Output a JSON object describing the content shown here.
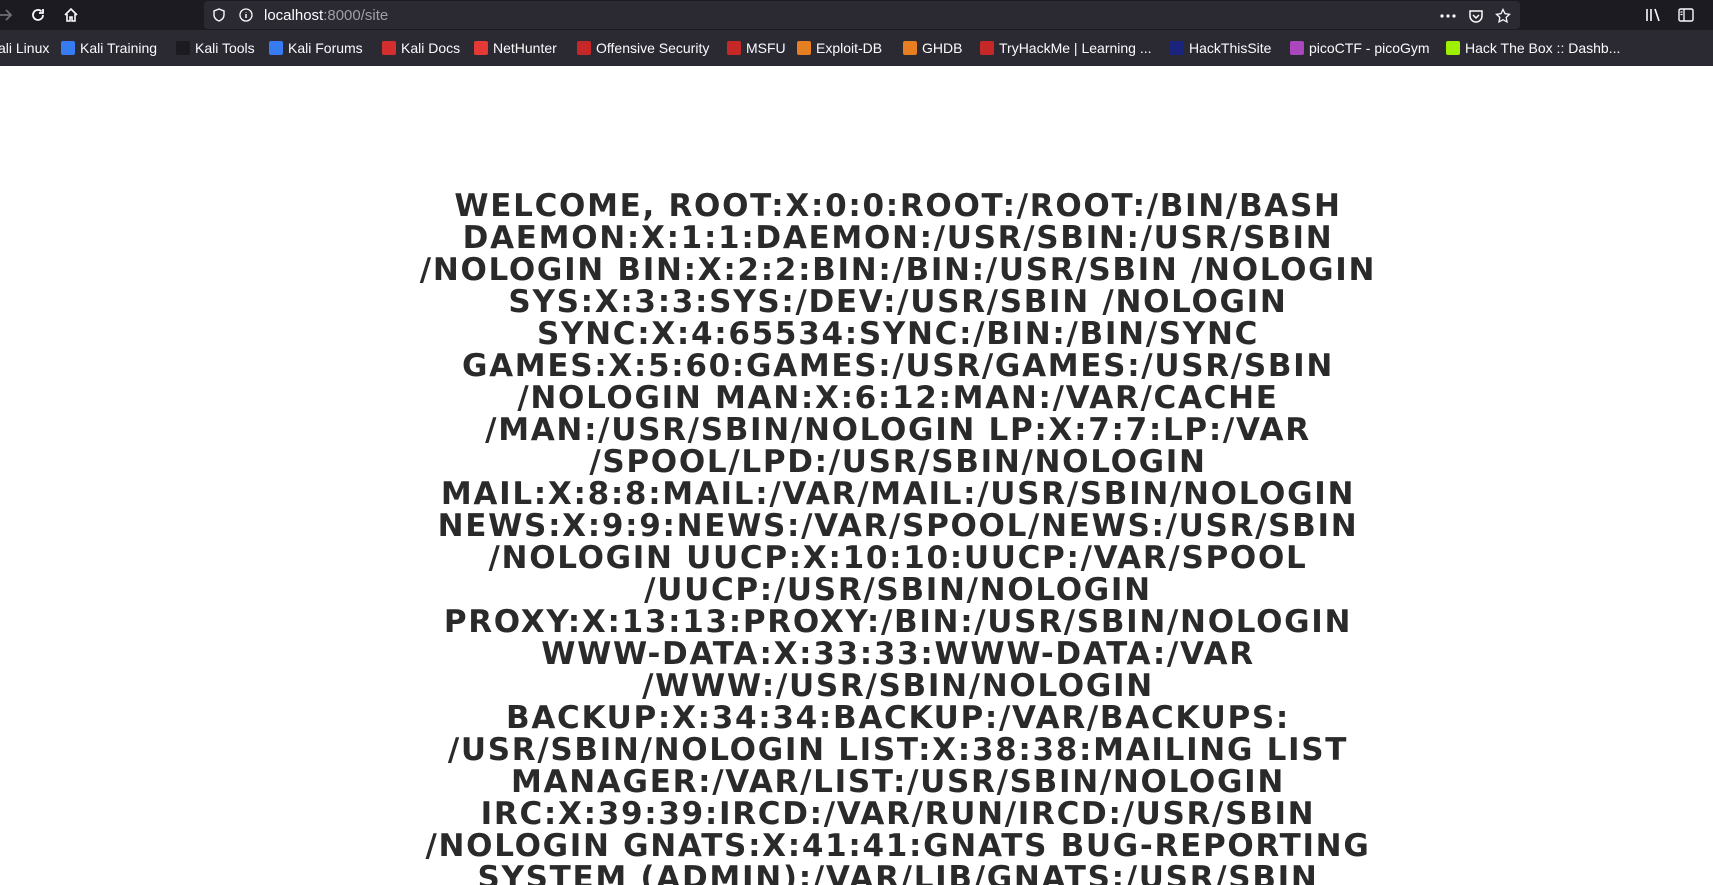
{
  "browser": {
    "url_host": "localhost",
    "url_path": ":8000/site",
    "bookmarks": [
      {
        "label": "ali Linux",
        "color": "#367bf0"
      },
      {
        "label": "Kali Training",
        "color": "#367bf0"
      },
      {
        "label": "Kali Tools",
        "color": "#1c1b22"
      },
      {
        "label": "Kali Forums",
        "color": "#367bf0"
      },
      {
        "label": "Kali Docs",
        "color": "#d32f2f"
      },
      {
        "label": "NetHunter",
        "color": "#e53935"
      },
      {
        "label": "Offensive Security",
        "color": "#c62828"
      },
      {
        "label": "MSFU",
        "color": "#c62828"
      },
      {
        "label": "Exploit-DB",
        "color": "#e67e22"
      },
      {
        "label": "GHDB",
        "color": "#e67e22"
      },
      {
        "label": "TryHackMe | Learning ...",
        "color": "#c62828"
      },
      {
        "label": "HackThisSite",
        "color": "#1a237e"
      },
      {
        "label": "picoCTF - picoGym",
        "color": "#ab47bc"
      },
      {
        "label": "Hack The Box :: Dashb...",
        "color": "#9fef00"
      }
    ]
  },
  "page": {
    "welcome_text": "WELCOME, ROOT:X:0:0:ROOT:/ROOT:/BIN/BASH DAEMON:X:1:1:DAEMON:/USR/SBIN:/USR/SBIN /NOLOGIN BIN:X:2:2:BIN:/BIN:/USR/SBIN /NOLOGIN SYS:X:3:3:SYS:/DEV:/USR/SBIN /NOLOGIN SYNC:X:4:65534:SYNC:/BIN:/BIN/SYNC GAMES:X:5:60:GAMES:/USR/GAMES:/USR/SBIN /NOLOGIN MAN:X:6:12:MAN:/VAR/CACHE /MAN:/USR/SBIN/NOLOGIN LP:X:7:7:LP:/VAR /SPOOL/LPD:/USR/SBIN/NOLOGIN MAIL:X:8:8:MAIL:/VAR/MAIL:/USR/SBIN/NOLOGIN NEWS:X:9:9:NEWS:/VAR/SPOOL/NEWS:/USR/SBIN /NOLOGIN UUCP:X:10:10:UUCP:/VAR/SPOOL /UUCP:/USR/SBIN/NOLOGIN PROXY:X:13:13:PROXY:/BIN:/USR/SBIN/NOLOGIN WWW-DATA:X:33:33:WWW-DATA:/VAR /WWW:/USR/SBIN/NOLOGIN BACKUP:X:34:34:BACKUP:/VAR/BACKUPS: /USR/SBIN/NOLOGIN LIST:X:38:38:MAILING LIST MANAGER:/VAR/LIST:/USR/SBIN/NOLOGIN IRC:X:39:39:IRCD:/VAR/RUN/IRCD:/USR/SBIN /NOLOGIN GNATS:X:41:41:GNATS BUG-REPORTING SYSTEM (ADMIN):/VAR/LIB/GNATS:/USR/SBIN"
  }
}
